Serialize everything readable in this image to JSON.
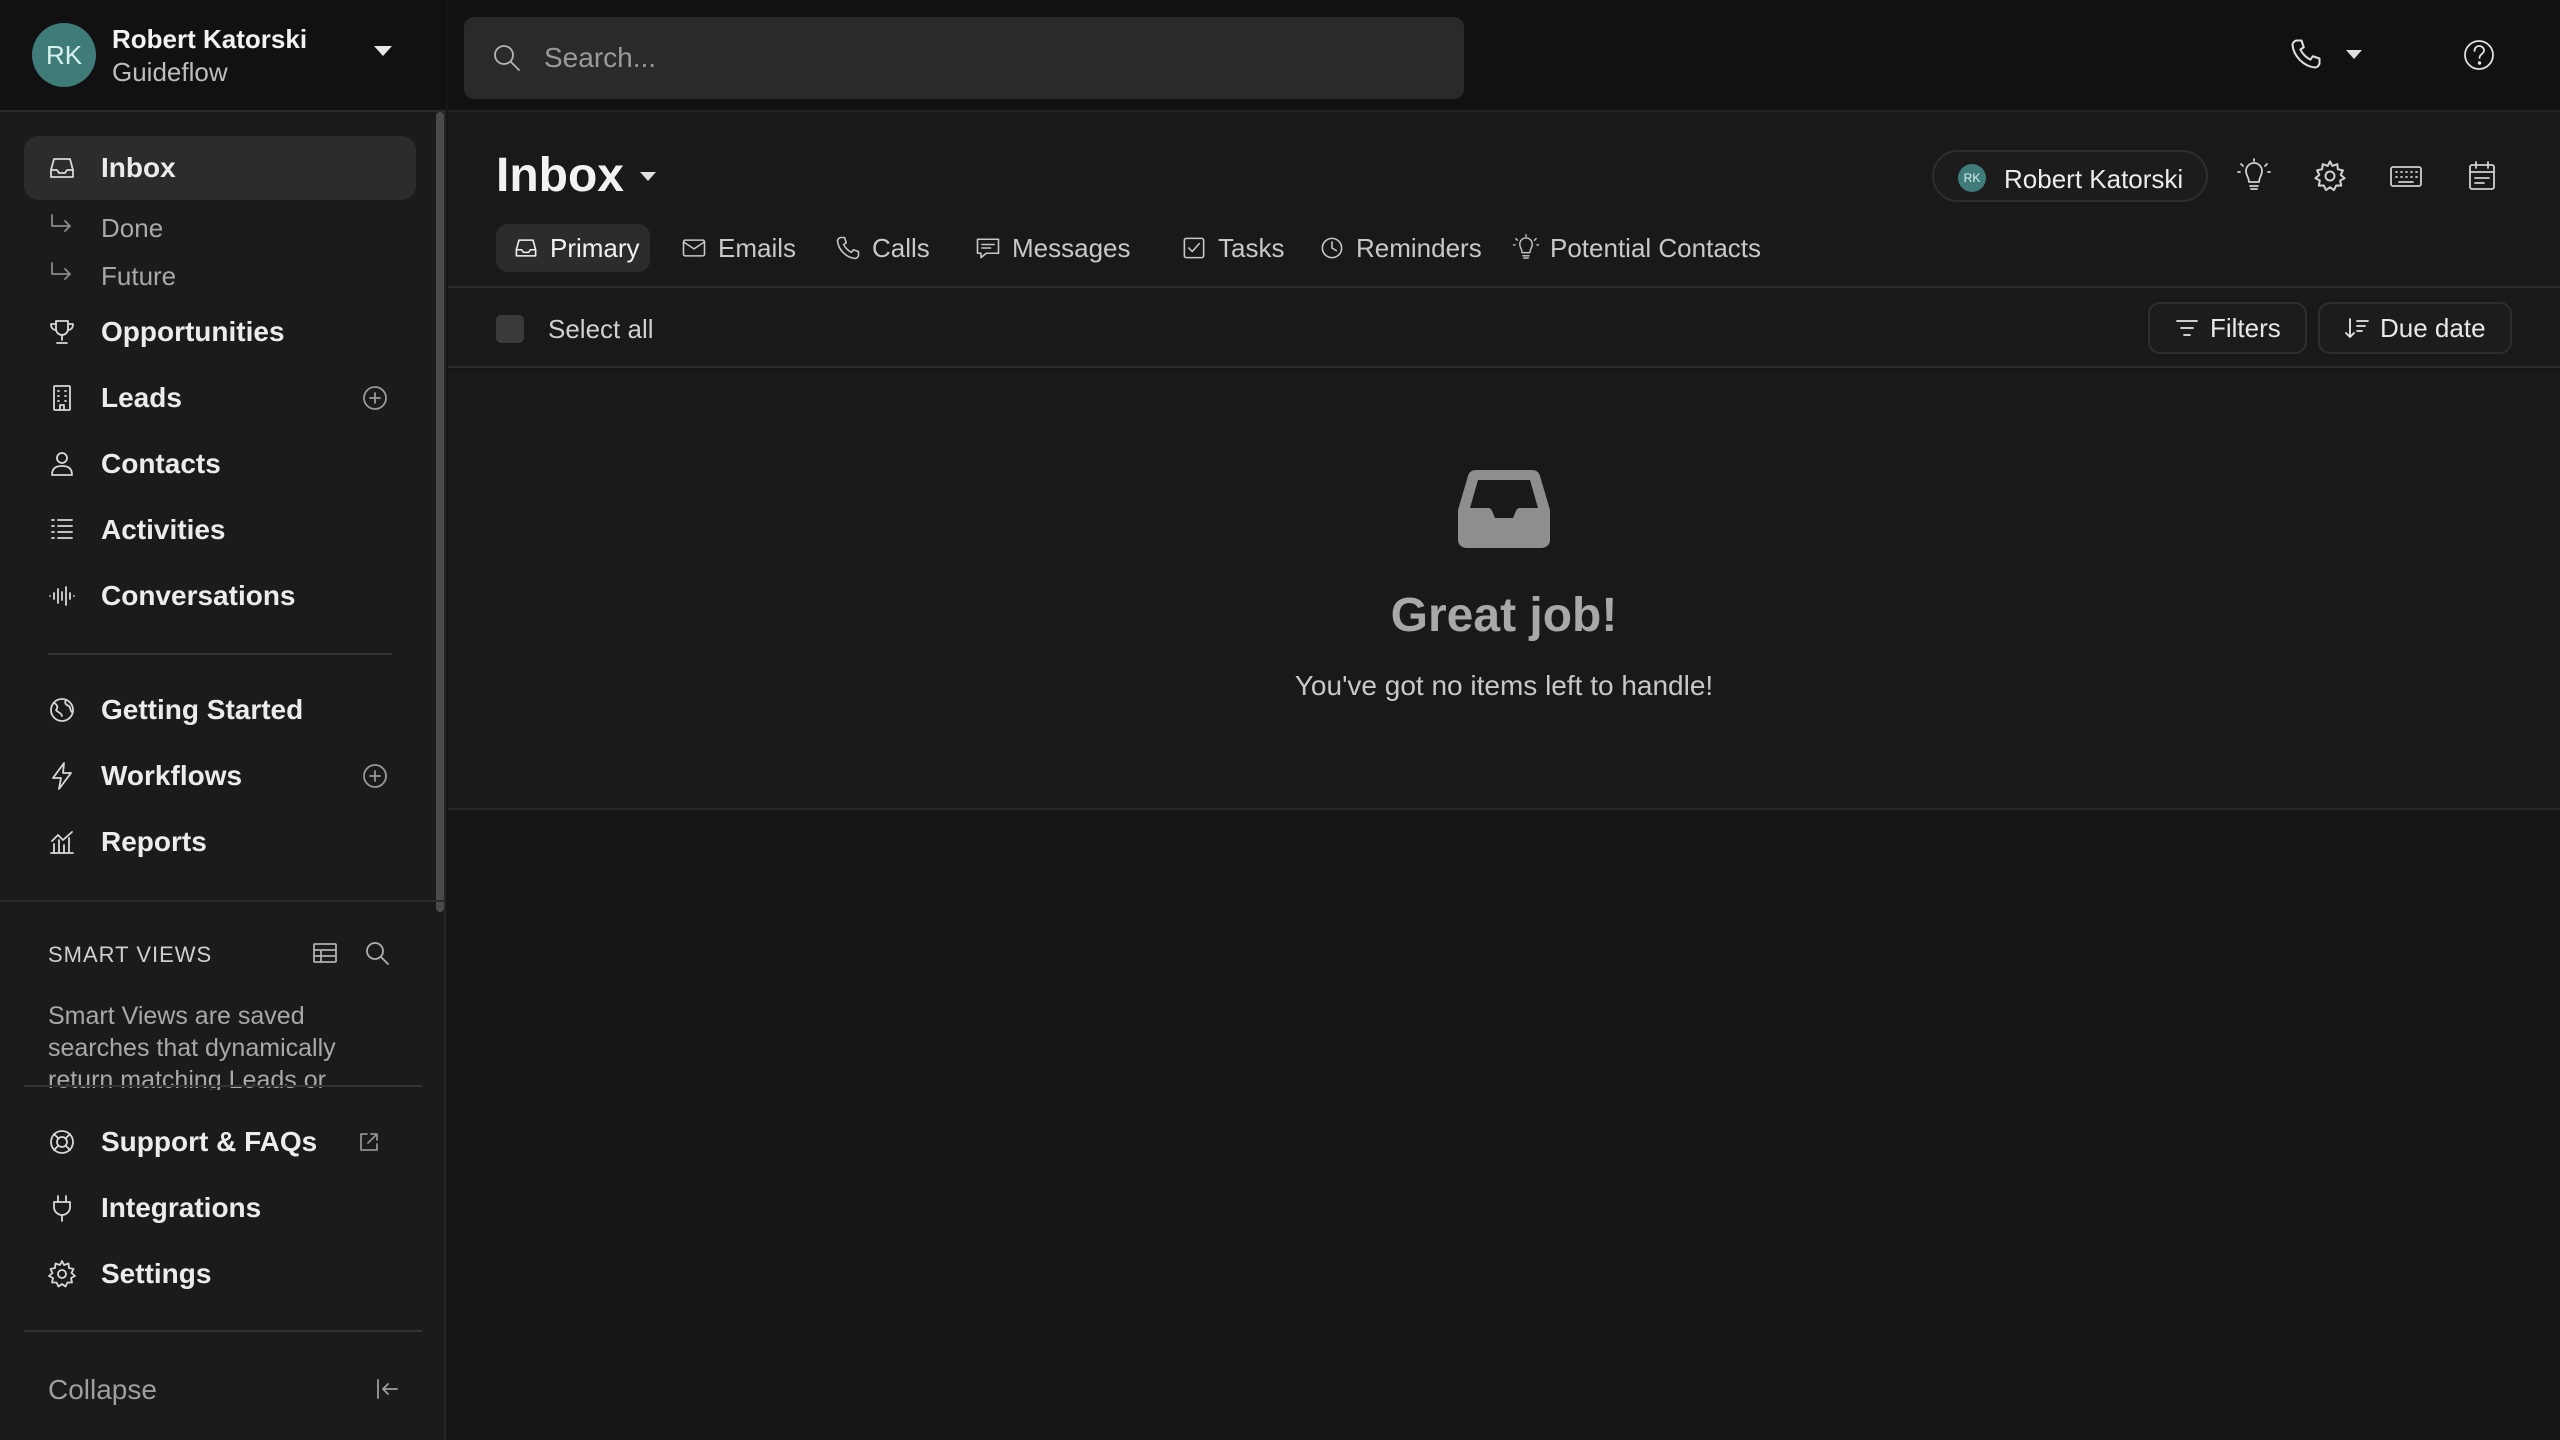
{
  "account": {
    "initials": "RK",
    "name": "Robert Katorski",
    "organization": "Guideflow"
  },
  "search": {
    "placeholder": "Search..."
  },
  "sidebar": {
    "items": [
      {
        "label": "Inbox",
        "icon": "inbox-icon",
        "active": true
      },
      {
        "label": "Done",
        "icon": "sub-arrow-icon"
      },
      {
        "label": "Future",
        "icon": "sub-arrow-icon"
      },
      {
        "label": "Opportunities",
        "icon": "trophy-icon"
      },
      {
        "label": "Leads",
        "icon": "building-icon"
      },
      {
        "label": "Contacts",
        "icon": "person-icon"
      },
      {
        "label": "Activities",
        "icon": "list-icon"
      },
      {
        "label": "Conversations",
        "icon": "audio-wave-icon"
      },
      {
        "label": "Getting Started",
        "icon": "globe-icon"
      },
      {
        "label": "Workflows",
        "icon": "lightning-icon"
      },
      {
        "label": "Reports",
        "icon": "chart-icon"
      }
    ],
    "smart_views": {
      "title": "SMART VIEWS",
      "description": "Smart Views are saved searches that dynamically return matching Leads or Contacts."
    },
    "bottom_items": [
      {
        "label": "Support & FAQs",
        "icon": "lifebuoy-icon"
      },
      {
        "label": "Integrations",
        "icon": "plug-icon"
      },
      {
        "label": "Settings",
        "icon": "gear-icon"
      }
    ],
    "collapse_label": "Collapse"
  },
  "header": {
    "title": "Inbox",
    "user_chip": {
      "initials": "RK",
      "name": "Robert Katorski"
    }
  },
  "tabs": [
    {
      "label": "Primary",
      "icon": "inbox-icon",
      "active": true
    },
    {
      "label": "Emails",
      "icon": "envelope-icon"
    },
    {
      "label": "Calls",
      "icon": "phone-icon"
    },
    {
      "label": "Messages",
      "icon": "message-icon"
    },
    {
      "label": "Tasks",
      "icon": "checkbox-icon"
    },
    {
      "label": "Reminders",
      "icon": "clock-icon"
    },
    {
      "label": "Potential Contacts",
      "icon": "lightbulb-icon"
    }
  ],
  "toolbar": {
    "select_all_label": "Select all",
    "filters_label": "Filters",
    "sort_label": "Due date"
  },
  "empty_state": {
    "title": "Great job!",
    "subtitle": "You've got no items left to handle!"
  },
  "colors": {
    "background": "#161616",
    "sidebar": "#1b1b1b",
    "active_item": "#2c2c2c",
    "avatar": "#3f7c79"
  }
}
